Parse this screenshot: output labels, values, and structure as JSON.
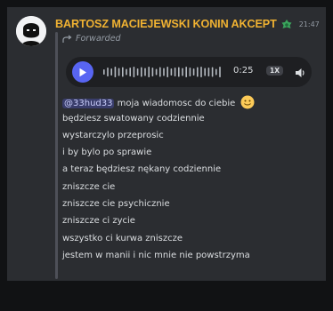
{
  "message": {
    "author": "BARTOSZ MACIEJEWSKI KONIN AKCEPT",
    "author_color": "#f0b232",
    "role_icon": "green-badge-icon",
    "role_icon_color": "#3ba55d",
    "timestamp": "21:47",
    "forwarded_label": "Forwarded",
    "voice_message": {
      "duration": "0:25",
      "speed": "1X",
      "play_button_color": "#5865f2"
    },
    "mention": "@33hud33",
    "lines": [
      "moja wiadomosc do ciebie",
      "będziesz swatowany codziennie",
      "wystarczylo przeprosic",
      "i by bylo po sprawie",
      "a teraz będziesz nękany codziennie",
      "zniszcze cie",
      "zniszcze cie psychicznie",
      "zniszcze ci zycie",
      "wszystko ci kurwa zniszcze",
      "jestem w manii i nic mnie nie powstrzyma"
    ],
    "emoji": "slightly-smiling-face"
  }
}
